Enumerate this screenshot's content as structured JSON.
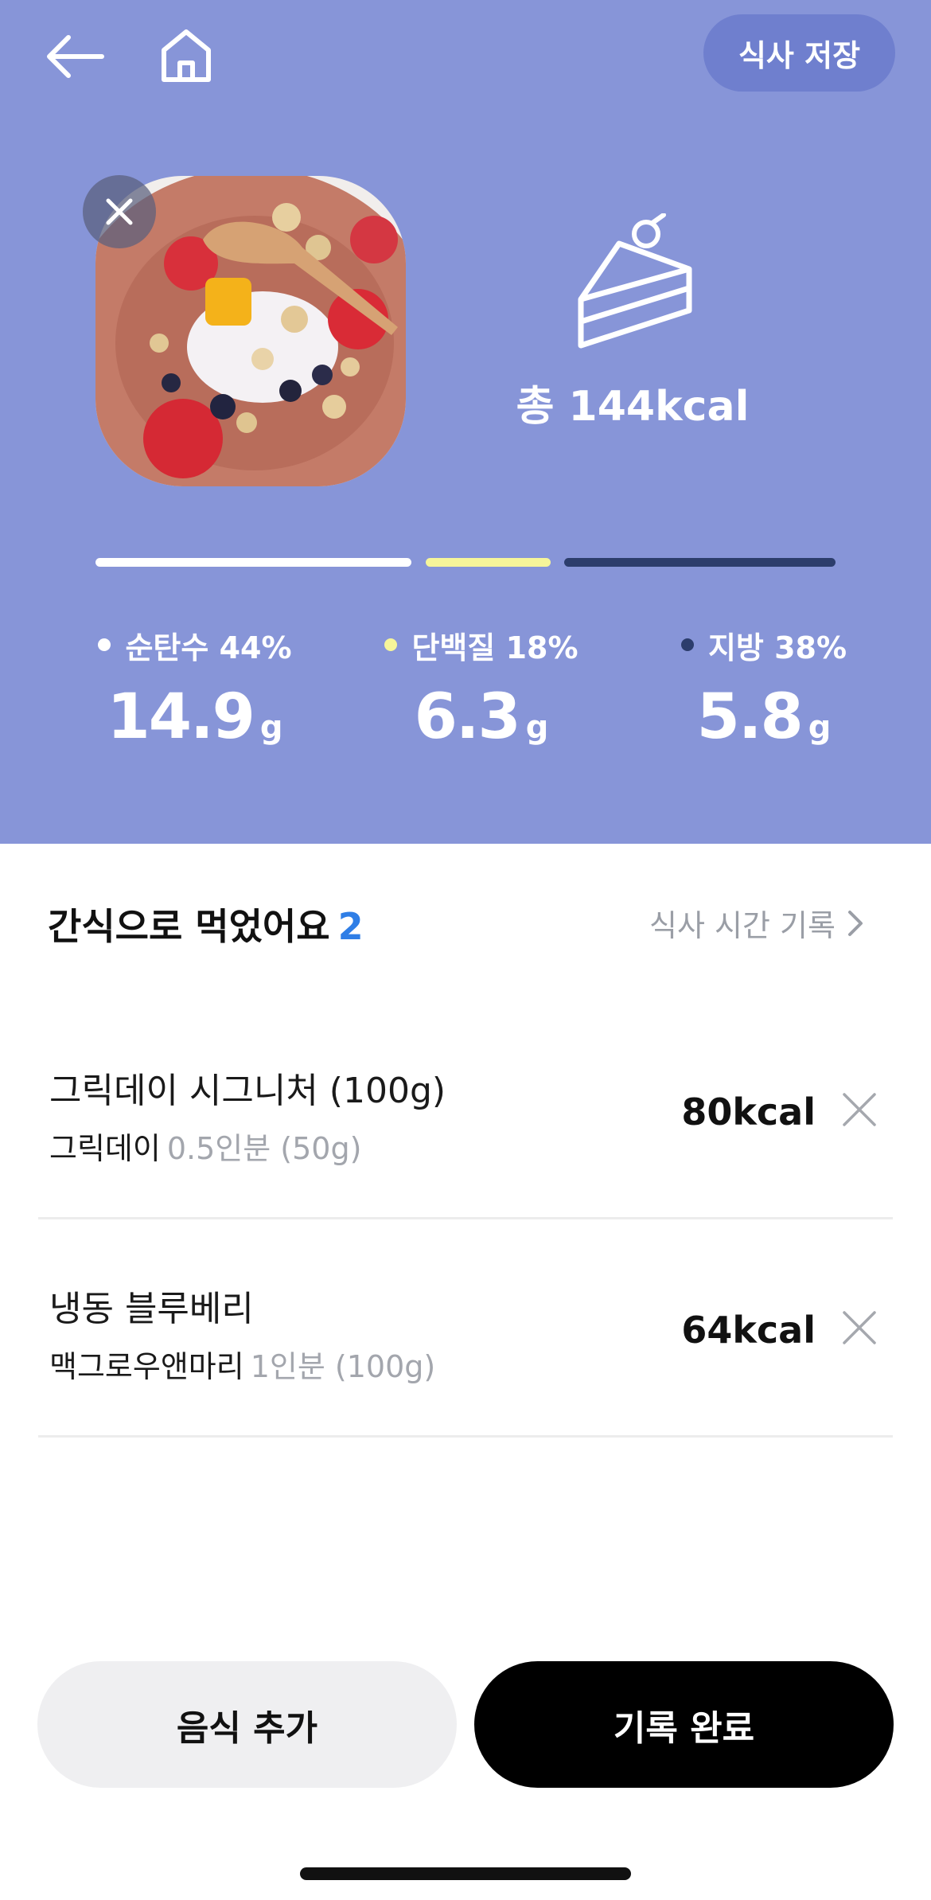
{
  "header": {
    "back_icon": "arrow-left-icon",
    "home_icon": "home-icon",
    "save_label": "식사 저장"
  },
  "photo": {
    "remove_icon": "close-icon",
    "subject": "bowl of granola with strawberries, mango, blueberries and yogurt"
  },
  "summary": {
    "icon": "cake-icon",
    "total_label": "총 144kcal"
  },
  "macros": {
    "carb": {
      "label": "순탄수 44%",
      "value": "14.9",
      "unit": "g",
      "percent": 44,
      "color": "#ffffff"
    },
    "protein": {
      "label": "단백질 18%",
      "value": "6.3",
      "unit": "g",
      "percent": 18,
      "color": "#f6f59a"
    },
    "fat": {
      "label": "지방 38%",
      "value": "5.8",
      "unit": "g",
      "percent": 38,
      "color": "#2c3d6c"
    }
  },
  "section": {
    "title": "간식으로 먹었어요",
    "count": "2",
    "meal_time_label": "식사 시간 기록",
    "meal_time_icon": "chevron-right-icon"
  },
  "foods": [
    {
      "name": "그릭데이 시그니처 (100g)",
      "brand": "그릭데이",
      "portion": "0.5인분 (50g)",
      "kcal": "80kcal",
      "remove_icon": "close-icon"
    },
    {
      "name": "냉동 블루베리",
      "brand": "맥그로우앤마리",
      "portion": "1인분 (100g)",
      "kcal": "64kcal",
      "remove_icon": "close-icon"
    }
  ],
  "actions": {
    "add_label": "음식 추가",
    "done_label": "기록 완료"
  },
  "colors": {
    "hero_bg": "#8795d8",
    "accent_blue": "#2f7ee6",
    "primary_button": "#000000"
  }
}
